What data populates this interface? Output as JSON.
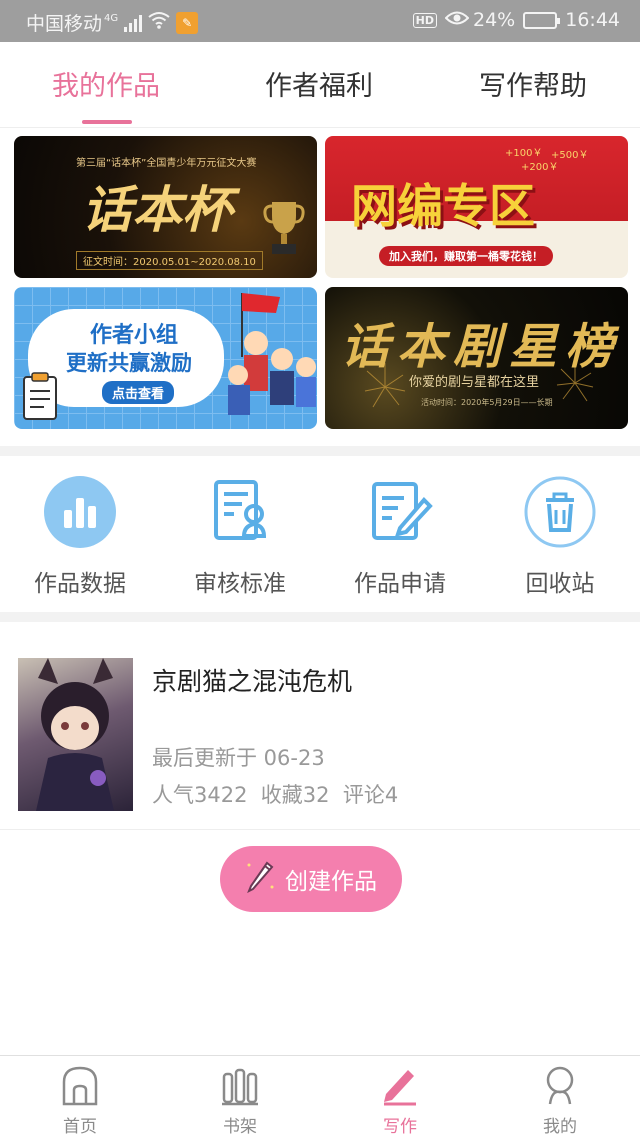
{
  "status_bar": {
    "carrier": "中国移动",
    "network": "4G",
    "battery": "24%",
    "time": "16:44",
    "hd": "HD"
  },
  "tabs": [
    {
      "label": "我的作品",
      "active": true
    },
    {
      "label": "作者福利",
      "active": false
    },
    {
      "label": "写作帮助",
      "active": false
    }
  ],
  "banners": {
    "b1": {
      "subtitle": "第三届“话本杯”全国青少年万元征文大赛",
      "title": "话本杯",
      "date": "征文时间：2020.05.01~2020.08.10"
    },
    "b2": {
      "bonus1": "+100￥",
      "bonus2": "+500￥",
      "bonus3": "+200￥",
      "title": "网编专区",
      "slogan": "加入我们，赚取第一桶零花钱！"
    },
    "b3": {
      "line1": "作者小组",
      "line2": "更新共赢激励",
      "button": "点击查看"
    },
    "b4": {
      "title": "话本剧星榜",
      "subtitle": "你爱的剧与星都在这里",
      "date": "活动时间：2020年5月29日——长期"
    }
  },
  "quick_actions": [
    {
      "label": "作品数据",
      "icon": "bar-chart-icon"
    },
    {
      "label": "审核标准",
      "icon": "review-doc-icon"
    },
    {
      "label": "作品申请",
      "icon": "edit-doc-icon"
    },
    {
      "label": "回收站",
      "icon": "trash-icon"
    }
  ],
  "work": {
    "title": "京剧猫之混沌危机",
    "updated": "最后更新于 06-23",
    "stats": "人气3422  收藏32  评论4"
  },
  "create_button": "创建作品",
  "bottom_nav": [
    {
      "label": "首页",
      "icon": "home-icon",
      "active": false
    },
    {
      "label": "书架",
      "icon": "bookshelf-icon",
      "active": false
    },
    {
      "label": "写作",
      "icon": "pen-icon",
      "active": true
    },
    {
      "label": "我的",
      "icon": "profile-icon",
      "active": false
    }
  ],
  "colors": {
    "accent": "#e8729a",
    "button": "#f47fae",
    "icon_blue": "#5aaee6"
  }
}
